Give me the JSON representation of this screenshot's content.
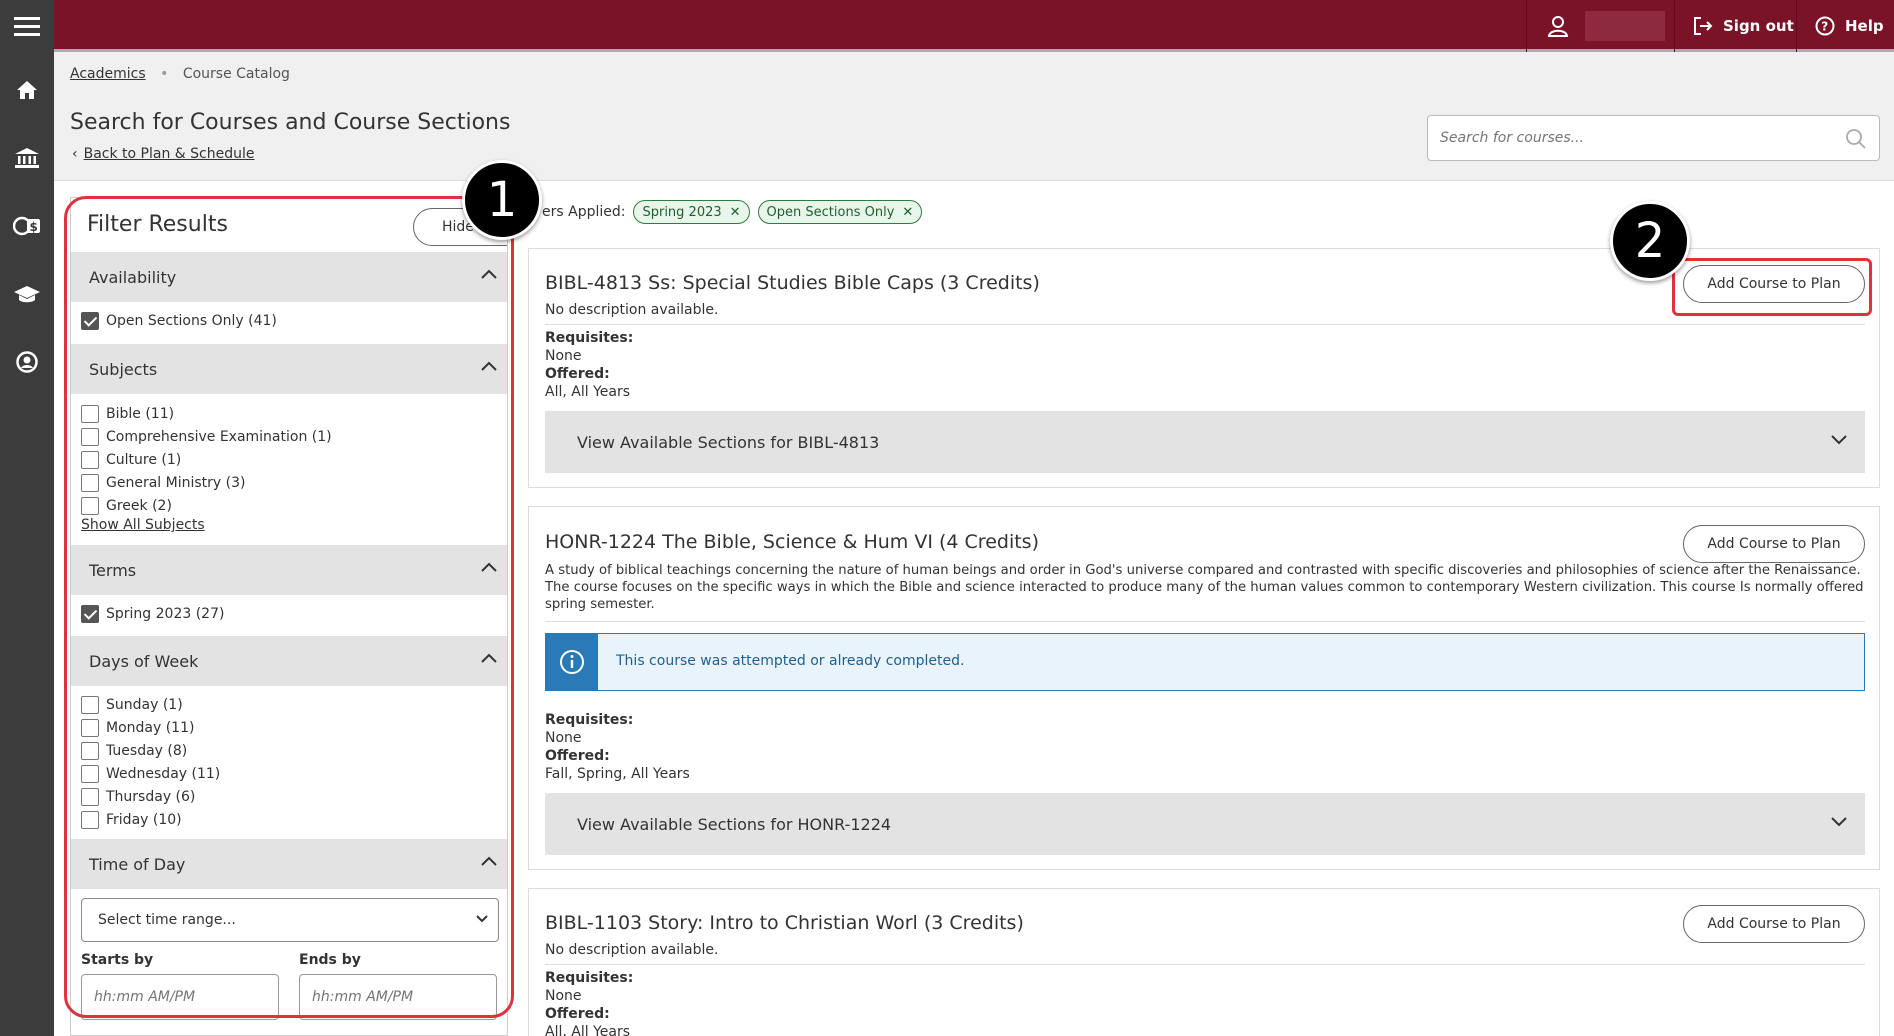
{
  "topbar": {
    "signout_label": "Sign out",
    "help_label": "Help"
  },
  "breadcrumb": {
    "academics": "Academics",
    "current": "Course Catalog"
  },
  "page": {
    "title": "Search for Courses and Course Sections",
    "back_link": "Back to Plan & Schedule"
  },
  "search": {
    "placeholder": "Search for courses..."
  },
  "filter": {
    "title": "Filter Results",
    "hide_label": "Hide",
    "sections": {
      "availability": "Availability",
      "subjects": "Subjects",
      "terms": "Terms",
      "days": "Days of Week",
      "time": "Time of Day"
    },
    "availability_options": [
      {
        "label": "Open Sections Only (41)",
        "checked": true
      }
    ],
    "subject_options": [
      {
        "label": "Bible (11)",
        "checked": false
      },
      {
        "label": "Comprehensive Examination (1)",
        "checked": false
      },
      {
        "label": "Culture (1)",
        "checked": false
      },
      {
        "label": "General Ministry (3)",
        "checked": false
      },
      {
        "label": "Greek (2)",
        "checked": false
      }
    ],
    "show_all_subjects": "Show All Subjects",
    "term_options": [
      {
        "label": "Spring 2023 (27)",
        "checked": true
      }
    ],
    "day_options": [
      {
        "label": "Sunday (1)",
        "checked": false
      },
      {
        "label": "Monday (11)",
        "checked": false
      },
      {
        "label": "Tuesday (8)",
        "checked": false
      },
      {
        "label": "Wednesday (11)",
        "checked": false
      },
      {
        "label": "Thursday (6)",
        "checked": false
      },
      {
        "label": "Friday (10)",
        "checked": false
      }
    ],
    "time_select": "Select time range...",
    "starts_by_label": "Starts by",
    "ends_by_label": "Ends by",
    "time_placeholder": "hh:mm AM/PM"
  },
  "applied": {
    "label": "ers Applied:",
    "pills": [
      "Spring 2023",
      "Open Sections Only"
    ]
  },
  "courses": [
    {
      "title": "BIBL-4813 Ss: Special Studies Bible Caps (3 Credits)",
      "description": "No description available.",
      "add_label": "Add Course to Plan",
      "requisites_label": "Requisites:",
      "requisites": "None",
      "offered_label": "Offered:",
      "offered": "All, All Years",
      "sections_label": "View Available Sections for BIBL-4813"
    },
    {
      "title": "HONR-1224 The Bible, Science & Hum VI (4 Credits)",
      "description": "A study of biblical teachings concerning the nature of human beings and order in God's universe compared and contrasted with specific discoveries and philosophies of science after the Renaissance. The course focuses on the specific ways in which the Bible and science interacted to produce many of the human values common to contemporary Western civilization. This course Is normally offered spring semester.",
      "add_label": "Add Course to Plan",
      "info": "This course was attempted or already completed.",
      "requisites_label": "Requisites:",
      "requisites": "None",
      "offered_label": "Offered:",
      "offered": "Fall, Spring, All Years",
      "sections_label": "View Available Sections for HONR-1224"
    },
    {
      "title": "BIBL-1103 Story: Intro to Christian Worl (3 Credits)",
      "description": "No description available.",
      "add_label": "Add Course to Plan",
      "requisites_label": "Requisites:",
      "requisites": "None",
      "offered_label": "Offered:",
      "offered": "All, All Years"
    }
  ],
  "annotations": [
    "1",
    "2"
  ],
  "colors": {
    "brand": "#7a1228",
    "rail": "#3c3c3c",
    "pill_green": "#2e7d3e",
    "info_blue": "#2a7ab8",
    "annotation_red": "#e0323c"
  }
}
